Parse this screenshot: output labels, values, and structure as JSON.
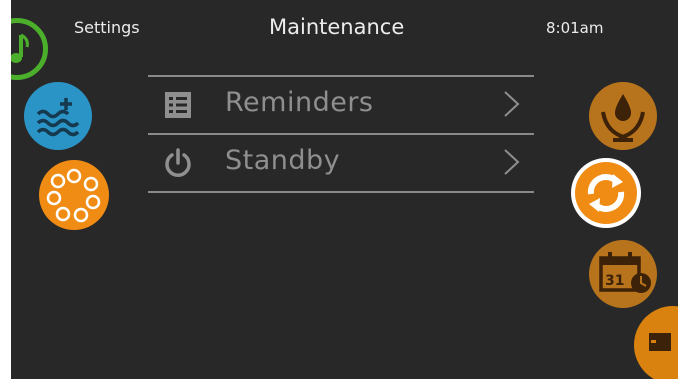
{
  "header": {
    "settings_label": "Settings",
    "title": "Maintenance",
    "time": "8:01am"
  },
  "menu": {
    "items": [
      {
        "label": "Reminders",
        "icon": "list-icon"
      },
      {
        "label": "Standby",
        "icon": "power-icon"
      }
    ]
  },
  "side_icons": {
    "left": [
      "music-icon",
      "water-add-icon",
      "gear-cluster-icon"
    ],
    "right": [
      "water-care-icon",
      "recycle-icon",
      "calendar-clock-icon",
      "exit-icon"
    ]
  },
  "calendar_day": "31",
  "colors": {
    "background": "#282828",
    "accent_orange": "#f08c14",
    "accent_green": "#4caf2c",
    "accent_blue": "#2b94c6",
    "bronze": "#b8741c"
  }
}
